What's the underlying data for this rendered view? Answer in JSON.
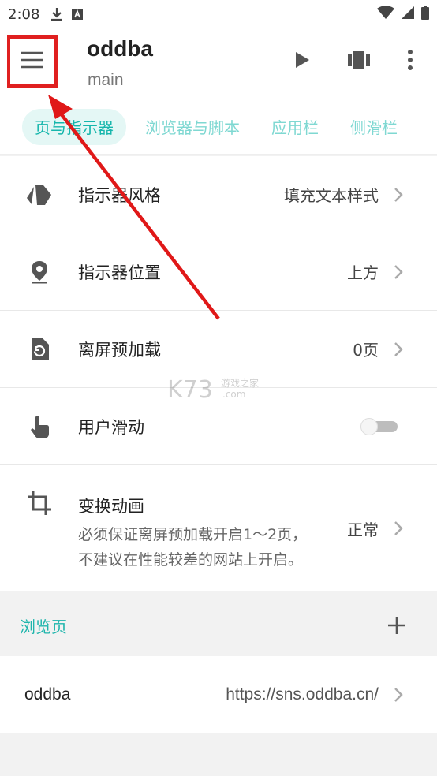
{
  "status": {
    "time": "2:08"
  },
  "appbar": {
    "title": "oddba",
    "subtitle": "main"
  },
  "tabs": [
    {
      "label": "页与指示器",
      "active": true
    },
    {
      "label": "浏览器与脚本",
      "active": false
    },
    {
      "label": "应用栏",
      "active": false
    },
    {
      "label": "侧滑栏",
      "active": false
    }
  ],
  "settings": [
    {
      "label": "指示器风格",
      "value": "填充文本样式",
      "icon": "tag-icon"
    },
    {
      "label": "指示器位置",
      "value": "上方",
      "icon": "location-pin-icon"
    },
    {
      "label": "离屏预加载",
      "value": "0页",
      "icon": "preload-icon"
    },
    {
      "label": "用户滑动",
      "value": "",
      "icon": "touch-icon",
      "toggle": false
    },
    {
      "label": "变换动画",
      "value": "正常",
      "icon": "crop-icon",
      "desc_line1": "必须保证离屏预加载开启1～2页，",
      "desc_line2": "不建议在性能较差的网站上开启。"
    }
  ],
  "section": {
    "title": "浏览页"
  },
  "pages": [
    {
      "name": "oddba",
      "url": "https://sns.oddba.cn/"
    }
  ],
  "colors": {
    "accent": "#1fb5ac",
    "highlight": "#e02020"
  }
}
